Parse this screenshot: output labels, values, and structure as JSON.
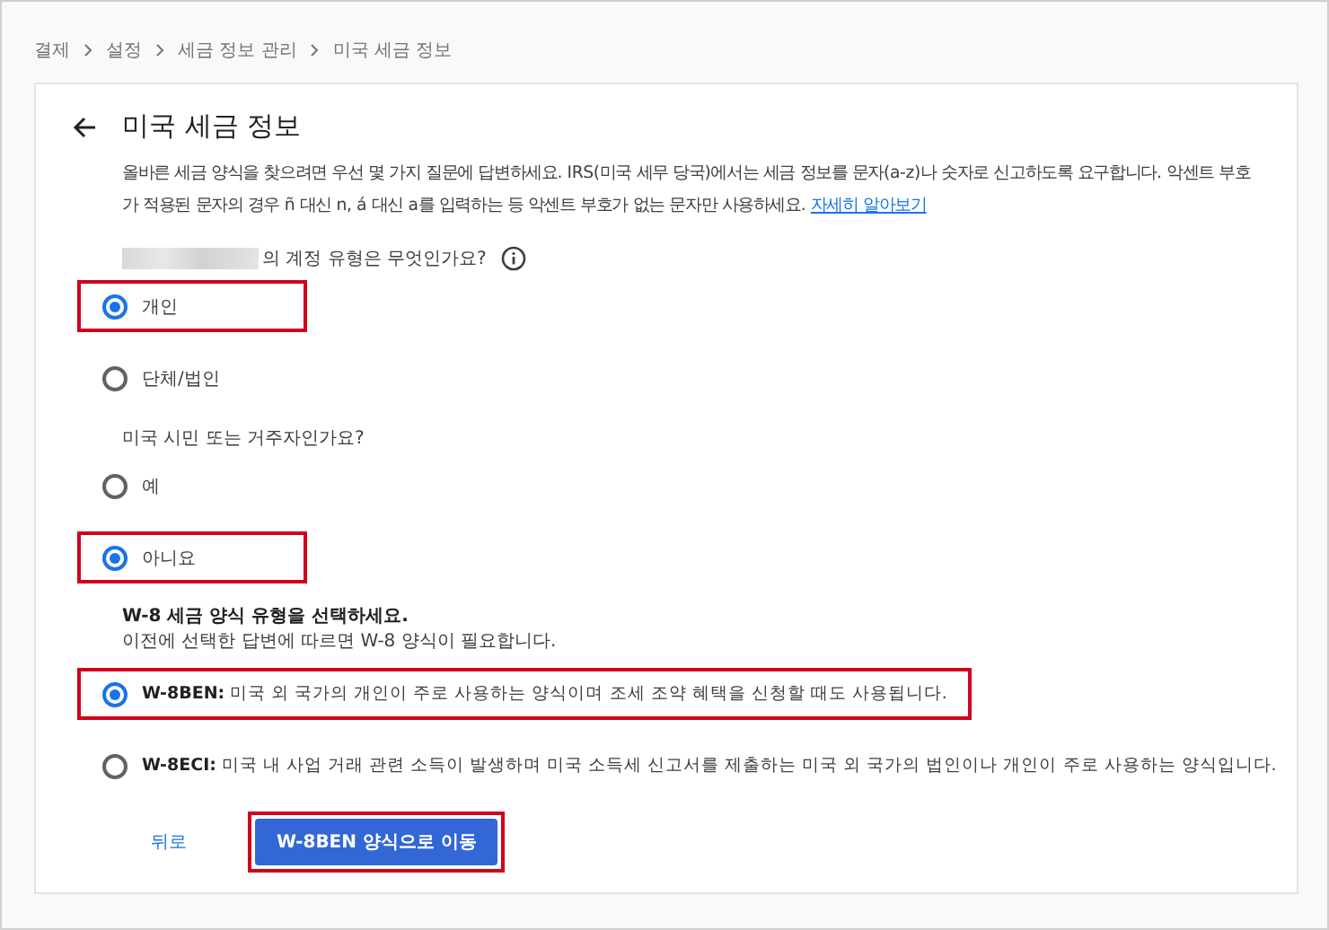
{
  "breadcrumb": [
    "결제",
    "설정",
    "세금 정보 관리",
    "미국 세금 정보"
  ],
  "page": {
    "title": "미국 세금 정보",
    "intro": "올바른 세금 양식을 찾으려면 우선 몇 가지 질문에 답변하세요. IRS(미국 세무 당국)에서는 세금 정보를 문자(a-z)나 숫자로 신고하도록 요구합니다. 악센트 부호가 적용된 문자의 경우 ñ 대신 n, á 대신 a를 입력하는 등 악센트 부호가 없는 문자만 사용하세요.",
    "learn_more": "자세히 알아보기"
  },
  "questions": [
    {
      "label": "의 계정 유형은 무엇인가요?",
      "redacted_prefix": true,
      "info": true,
      "options": [
        {
          "label": "개인",
          "selected": true,
          "highlighted": true
        },
        {
          "label": "단체/법인",
          "selected": false,
          "highlighted": false
        }
      ]
    },
    {
      "label": "미국 시민 또는 거주자인가요?",
      "redacted_prefix": false,
      "info": false,
      "options": [
        {
          "label": "예",
          "selected": false,
          "highlighted": false
        },
        {
          "label": "아니요",
          "selected": true,
          "highlighted": true
        }
      ]
    }
  ],
  "form_type": {
    "heading": "W-8 세금 양식 유형을 선택하세요.",
    "subtext": "이전에 선택한 답변에 따르면 W-8 양식이 필요합니다.",
    "options": [
      {
        "code": "W-8BEN:",
        "description": "미국 외 국가의 개인이 주로 사용하는 양식이며 조세 조약 혜택을 신청할 때도 사용됩니다.",
        "selected": true,
        "highlighted": true
      },
      {
        "code": "W-8ECI:",
        "description": "미국 내 사업 거래 관련 소득이 발생하며 미국 소득세 신고서를 제출하는 미국 외 국가의 법인이나 개인이 주로 사용하는 양식입니다.",
        "selected": false,
        "highlighted": false
      }
    ]
  },
  "buttons": {
    "back": "뒤로",
    "primary": {
      "label": "W-8BEN 양식으로 이동",
      "highlighted": true
    }
  }
}
